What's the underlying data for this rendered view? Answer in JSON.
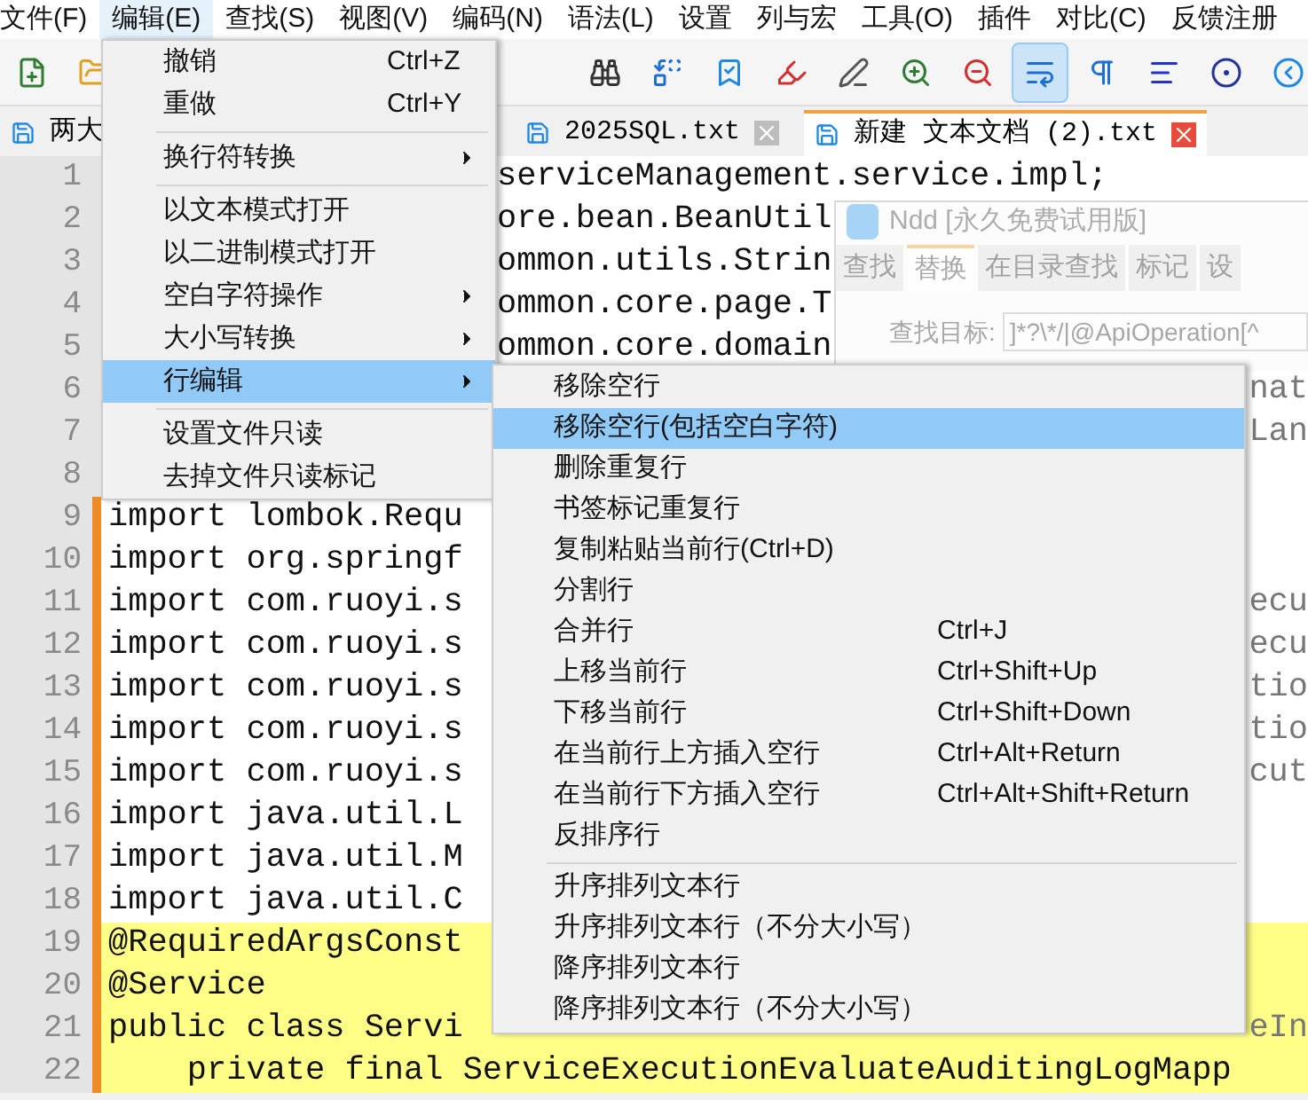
{
  "menu_bar": [
    {
      "label": "文件(F)",
      "selected": false
    },
    {
      "label": "编辑(E)",
      "selected": true
    },
    {
      "label": "查找(S)",
      "selected": false
    },
    {
      "label": "视图(V)",
      "selected": false
    },
    {
      "label": "编码(N)",
      "selected": false
    },
    {
      "label": "语法(L)",
      "selected": false
    },
    {
      "label": "设置",
      "selected": false
    },
    {
      "label": "列与宏",
      "selected": false
    },
    {
      "label": "工具(O)",
      "selected": false
    },
    {
      "label": "插件",
      "selected": false
    },
    {
      "label": "对比(C)",
      "selected": false
    },
    {
      "label": "反馈注册",
      "selected": false
    }
  ],
  "toolbar": {
    "left": [
      {
        "selected": false
      },
      {
        "selected": false
      }
    ],
    "right": [
      {
        "selected": false
      },
      {
        "selected": false
      },
      {
        "selected": false
      },
      {
        "selected": false
      },
      {
        "selected": false
      },
      {
        "selected": false
      },
      {
        "selected": false
      },
      {
        "selected": true
      },
      {
        "selected": false
      },
      {
        "selected": false
      },
      {
        "selected": false
      },
      {
        "selected": false
      }
    ]
  },
  "tabs": [
    {
      "label": "两大",
      "selected": false,
      "closable": false
    },
    {
      "label": "2025SQL.txt",
      "selected": false,
      "closable": true
    },
    {
      "label": "新建 文本文档 (2).txt",
      "selected": true,
      "closable": true
    }
  ],
  "editor": {
    "lines": [
      {
        "number": "1",
        "kind": "after-menu",
        "text": "serviceManagement.service.impl;",
        "changed": false,
        "highlighted": false
      },
      {
        "number": "2",
        "kind": "after-menu",
        "text": "ore.bean.BeanUtil",
        "changed": false,
        "highlighted": false
      },
      {
        "number": "3",
        "kind": "after-menu",
        "text": "ommon.utils.Strin",
        "changed": false,
        "highlighted": false
      },
      {
        "number": "4",
        "kind": "after-menu",
        "text": "ommon.core.page.T",
        "changed": false,
        "highlighted": false
      },
      {
        "number": "5",
        "kind": "after-menu",
        "text": "ommon.core.domain",
        "changed": false,
        "highlighted": false
      },
      {
        "number": "6",
        "kind": "tail-only",
        "tail": "nat",
        "changed": false,
        "highlighted": false
      },
      {
        "number": "7",
        "kind": "tail-only",
        "tail": "Lan",
        "changed": false,
        "highlighted": false
      },
      {
        "number": "8",
        "kind": "hidden",
        "changed": false,
        "highlighted": false
      },
      {
        "number": "9",
        "kind": "full",
        "text": "import lombok.Requ",
        "changed": true,
        "highlighted": false
      },
      {
        "number": "10",
        "kind": "full",
        "text": "import org.springf",
        "changed": true,
        "highlighted": false
      },
      {
        "number": "11",
        "kind": "full",
        "text": "import com.ruoyi.s",
        "tail": "ecu",
        "changed": true,
        "highlighted": false
      },
      {
        "number": "12",
        "kind": "full",
        "text": "import com.ruoyi.s",
        "tail": "ecu",
        "changed": true,
        "highlighted": false
      },
      {
        "number": "13",
        "kind": "full",
        "text": "import com.ruoyi.s",
        "tail": "tio",
        "changed": true,
        "highlighted": false
      },
      {
        "number": "14",
        "kind": "full",
        "text": "import com.ruoyi.s",
        "tail": "tio",
        "changed": true,
        "highlighted": false
      },
      {
        "number": "15",
        "kind": "full",
        "text": "import com.ruoyi.s",
        "tail": "cut",
        "changed": true,
        "highlighted": false
      },
      {
        "number": "16",
        "kind": "full",
        "text": "import java.util.L",
        "changed": true,
        "highlighted": false
      },
      {
        "number": "17",
        "kind": "full",
        "text": "import java.util.M",
        "changed": true,
        "highlighted": false
      },
      {
        "number": "18",
        "kind": "full",
        "text": "import java.util.C",
        "changed": true,
        "highlighted": false
      },
      {
        "number": "19",
        "kind": "full",
        "text": "@RequiredArgsConst",
        "changed": true,
        "highlighted": true
      },
      {
        "number": "20",
        "kind": "full",
        "text": "@Service ",
        "changed": true,
        "highlighted": true
      },
      {
        "number": "21",
        "kind": "full",
        "text": "public class Servi",
        "tail": "eIn",
        "changed": true,
        "highlighted": true
      },
      {
        "number": "22",
        "kind": "full",
        "text": "    private final ServiceExecutionEvaluateAuditingLogMapp",
        "changed": true,
        "highlighted": true
      }
    ]
  },
  "find_dialog": {
    "title": "Ndd [永久免费试用版]",
    "tabs": [
      {
        "label": "查找",
        "selected": false
      },
      {
        "label": "替换",
        "selected": true
      },
      {
        "label": "在目录查找",
        "selected": false
      },
      {
        "label": "标记",
        "selected": false
      },
      {
        "label": "设",
        "selected": false
      }
    ],
    "find_label": "查找目标:",
    "find_value": "]*?\\*/|@ApiOperation[^"
  },
  "edit_menu": [
    {
      "kind": "item",
      "label": "撤销",
      "shortcut": "Ctrl+Z",
      "selected": false
    },
    {
      "kind": "item",
      "label": "重做",
      "shortcut": "Ctrl+Y",
      "selected": false
    },
    {
      "kind": "separator"
    },
    {
      "kind": "submenu",
      "label": "换行符转换",
      "selected": false
    },
    {
      "kind": "separator"
    },
    {
      "kind": "item",
      "label": "以文本模式打开",
      "selected": false
    },
    {
      "kind": "item",
      "label": "以二进制模式打开",
      "selected": false
    },
    {
      "kind": "submenu",
      "label": "空白字符操作",
      "selected": false
    },
    {
      "kind": "submenu",
      "label": "大小写转换",
      "selected": false
    },
    {
      "kind": "submenu",
      "label": "行编辑",
      "selected": true
    },
    {
      "kind": "separator"
    },
    {
      "kind": "item",
      "label": "设置文件只读",
      "selected": false
    },
    {
      "kind": "item",
      "label": "去掉文件只读标记",
      "selected": false
    }
  ],
  "line_edit_submenu": [
    {
      "kind": "item",
      "label": "移除空行",
      "selected": false
    },
    {
      "kind": "item",
      "label": "移除空行(包括空白字符)",
      "selected": true
    },
    {
      "kind": "item",
      "label": "删除重复行",
      "selected": false
    },
    {
      "kind": "item",
      "label": "书签标记重复行",
      "selected": false
    },
    {
      "kind": "item",
      "label": "复制粘贴当前行(Ctrl+D)",
      "selected": false
    },
    {
      "kind": "item",
      "label": "分割行",
      "selected": false
    },
    {
      "kind": "item",
      "label": "合并行",
      "shortcut": "Ctrl+J",
      "selected": false
    },
    {
      "kind": "item",
      "label": "上移当前行",
      "shortcut": "Ctrl+Shift+Up",
      "selected": false
    },
    {
      "kind": "item",
      "label": "下移当前行",
      "shortcut": "Ctrl+Shift+Down",
      "selected": false
    },
    {
      "kind": "item",
      "label": "在当前行上方插入空行",
      "shortcut": "Ctrl+Alt+Return",
      "selected": false
    },
    {
      "kind": "item",
      "label": "在当前行下方插入空行",
      "shortcut": "Ctrl+Alt+Shift+Return",
      "selected": false
    },
    {
      "kind": "item",
      "label": "反排序行",
      "selected": false
    },
    {
      "kind": "separator"
    },
    {
      "kind": "item",
      "label": "升序排列文本行",
      "selected": false
    },
    {
      "kind": "item",
      "label": "升序排列文本行（不分大小写）",
      "selected": false
    },
    {
      "kind": "item",
      "label": "降序排列文本行",
      "selected": false
    },
    {
      "kind": "item",
      "label": "降序排列文本行（不分大小写）",
      "selected": false
    }
  ]
}
